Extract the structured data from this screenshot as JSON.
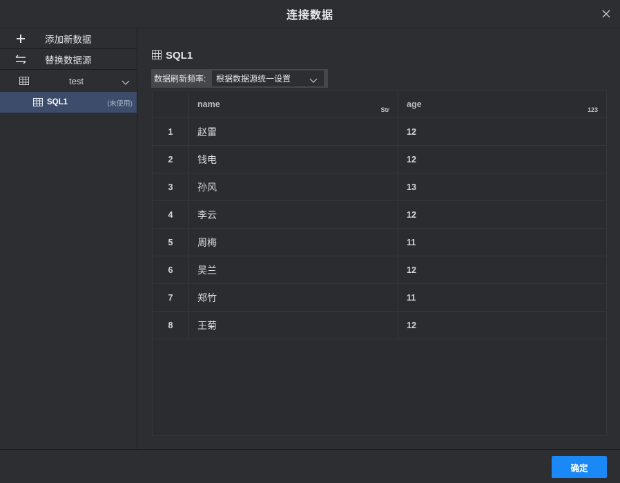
{
  "dialog": {
    "title": "连接数据",
    "close_icon": "close-icon"
  },
  "sidebar": {
    "actions": [
      {
        "label": "添加新数据",
        "icon": "plus-icon"
      },
      {
        "label": "替换数据源",
        "icon": "swap-icon"
      }
    ],
    "group": {
      "label": "test",
      "icon": "table-icon",
      "expanded": true
    },
    "items": [
      {
        "label": "SQL1",
        "tag": "(未使用)",
        "icon": "table-icon",
        "selected": true
      }
    ]
  },
  "main": {
    "title": "SQL1",
    "refresh": {
      "label": "数据刷新频率:",
      "value": "根据数据源统一设置"
    },
    "table": {
      "columns": [
        {
          "name": "name",
          "type": "Str"
        },
        {
          "name": "age",
          "type": "123"
        }
      ],
      "rows": [
        {
          "idx": "1",
          "name": "赵雷",
          "age": "12"
        },
        {
          "idx": "2",
          "name": "钱电",
          "age": "12"
        },
        {
          "idx": "3",
          "name": "孙风",
          "age": "13"
        },
        {
          "idx": "4",
          "name": "李云",
          "age": "12"
        },
        {
          "idx": "5",
          "name": "周梅",
          "age": "11"
        },
        {
          "idx": "6",
          "name": "吴兰",
          "age": "12"
        },
        {
          "idx": "7",
          "name": "郑竹",
          "age": "11"
        },
        {
          "idx": "8",
          "name": "王菊",
          "age": "12"
        }
      ]
    }
  },
  "footer": {
    "ok_label": "确定"
  },
  "colors": {
    "accent": "#1a88f5",
    "selected_bg": "#3c4c6a",
    "background": "#2d2e32"
  }
}
